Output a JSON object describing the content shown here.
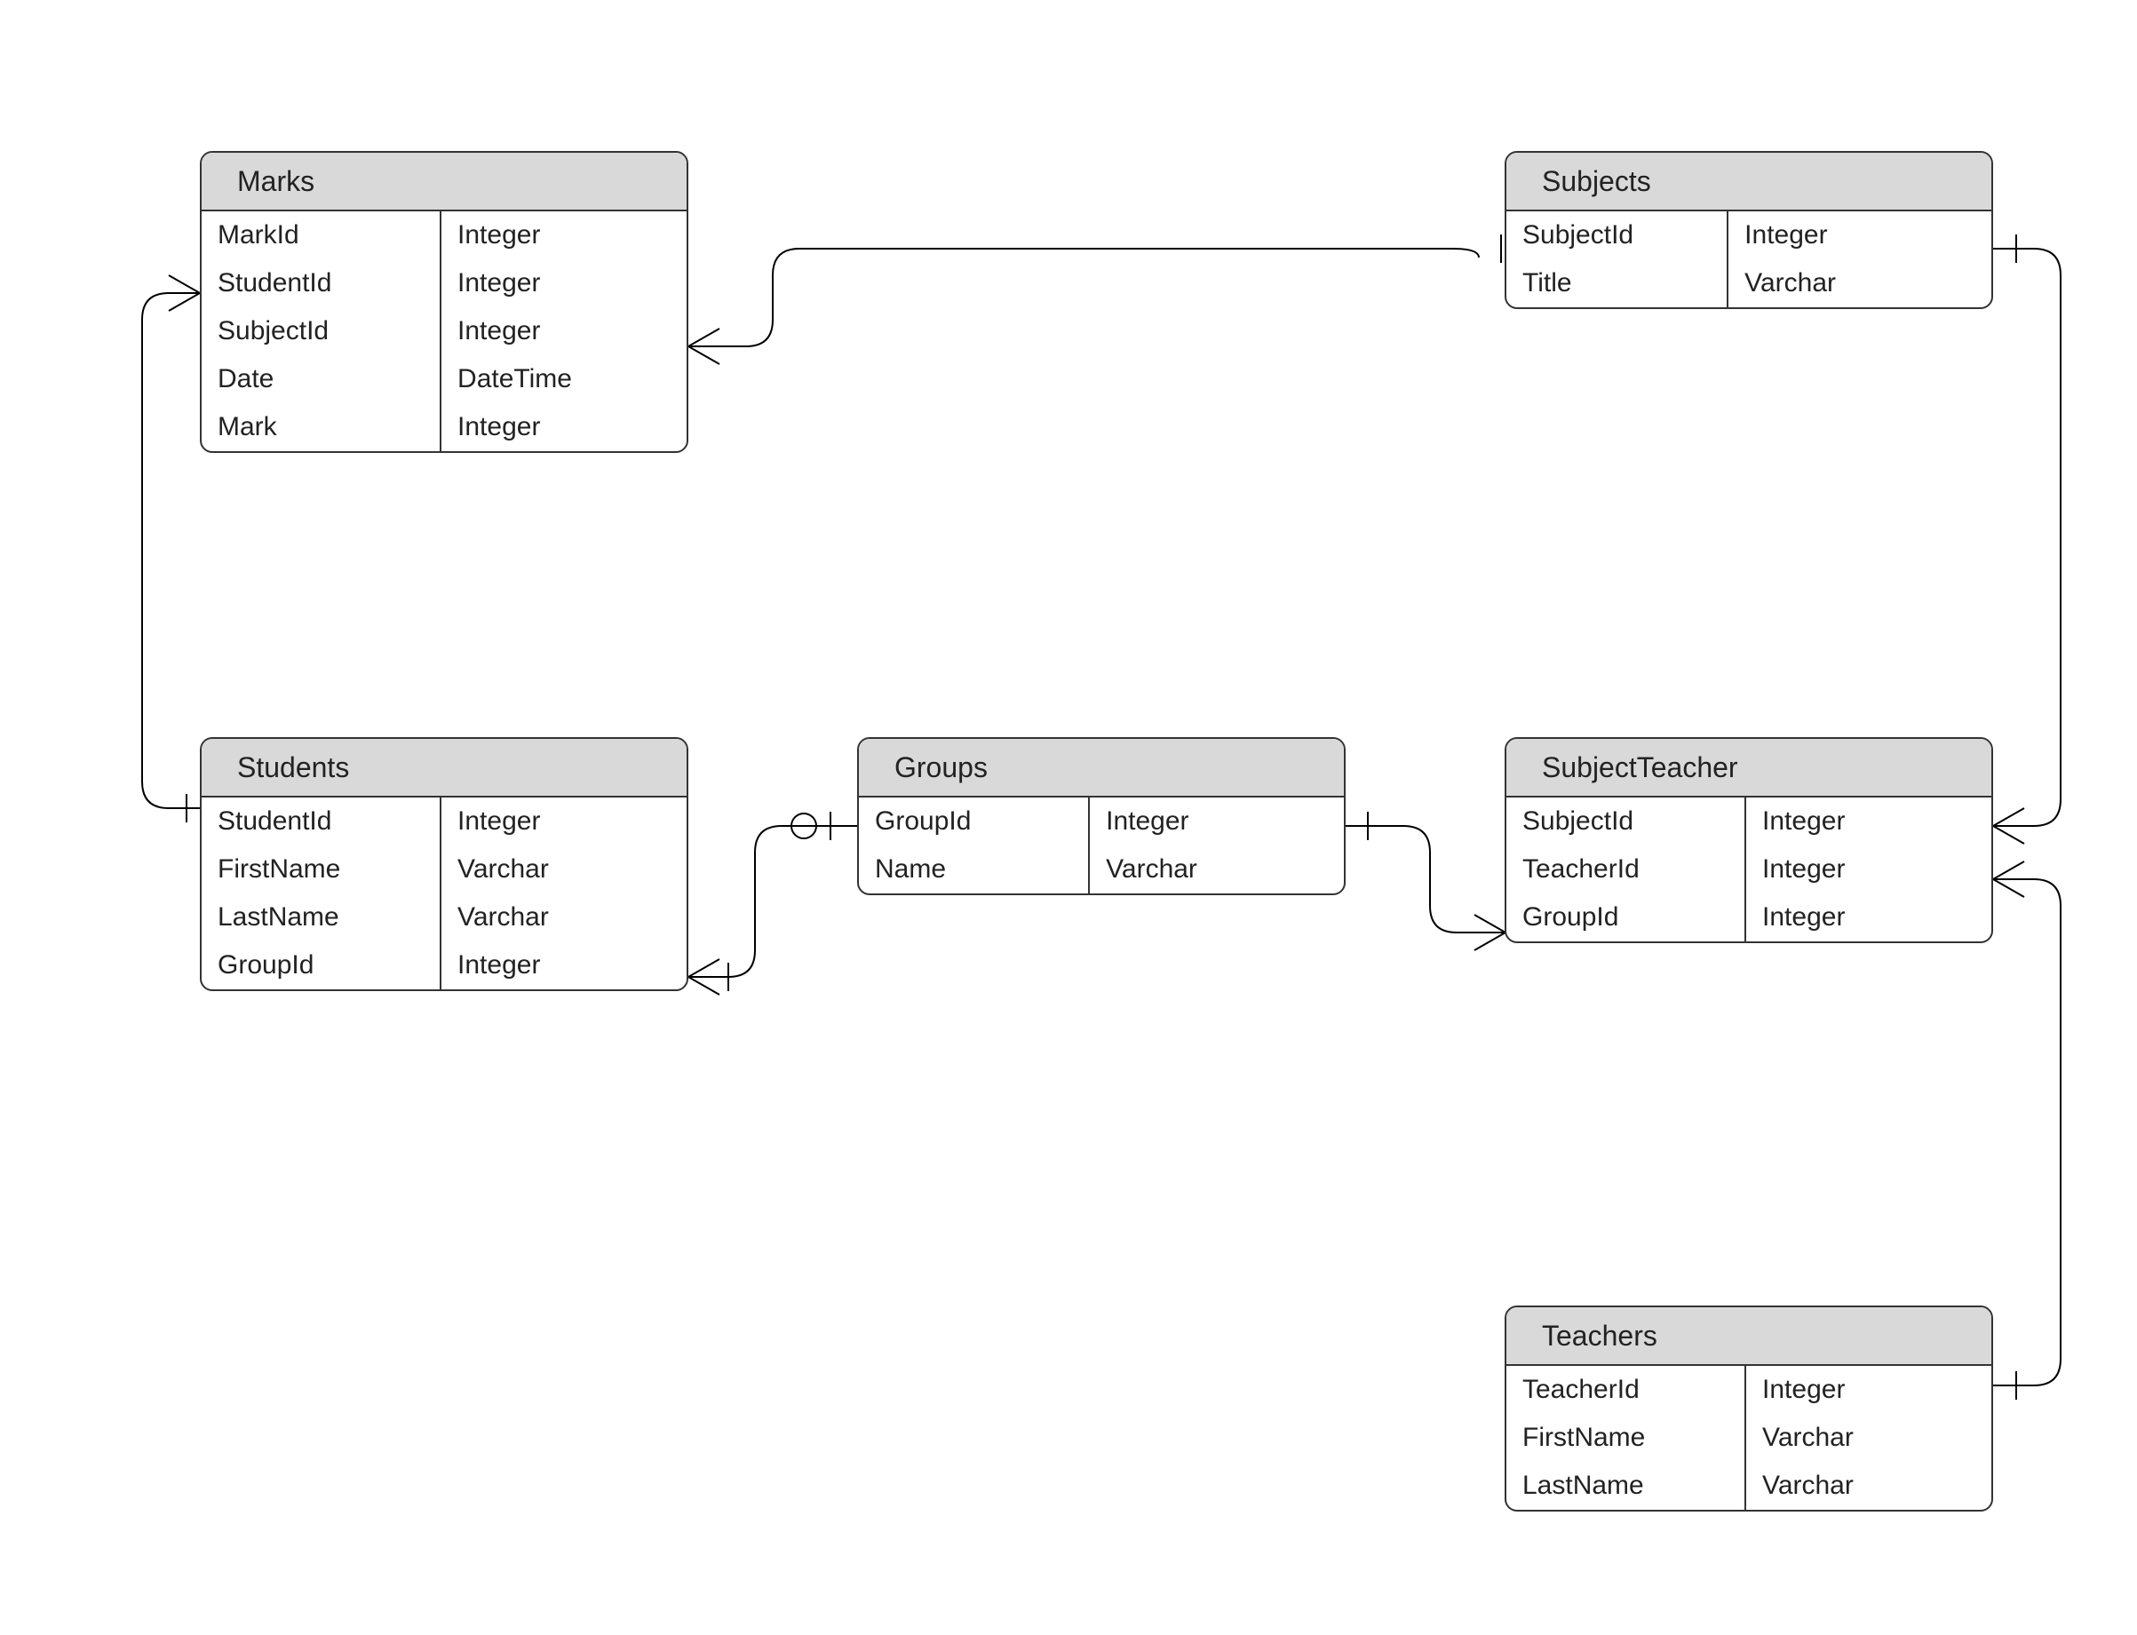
{
  "entities": {
    "marks": {
      "title": "Marks",
      "fields": [
        {
          "name": "MarkId",
          "type": "Integer"
        },
        {
          "name": "StudentId",
          "type": "Integer"
        },
        {
          "name": "SubjectId",
          "type": "Integer"
        },
        {
          "name": "Date",
          "type": "DateTime"
        },
        {
          "name": "Mark",
          "type": "Integer"
        }
      ]
    },
    "subjects": {
      "title": "Subjects",
      "fields": [
        {
          "name": "SubjectId",
          "type": "Integer"
        },
        {
          "name": "Title",
          "type": "Varchar"
        }
      ]
    },
    "students": {
      "title": "Students",
      "fields": [
        {
          "name": "StudentId",
          "type": "Integer"
        },
        {
          "name": "FirstName",
          "type": "Varchar"
        },
        {
          "name": "LastName",
          "type": "Varchar"
        },
        {
          "name": "GroupId",
          "type": "Integer"
        }
      ]
    },
    "groups": {
      "title": "Groups",
      "fields": [
        {
          "name": "GroupId",
          "type": "Integer"
        },
        {
          "name": "Name",
          "type": "Varchar"
        }
      ]
    },
    "subjectteacher": {
      "title": "SubjectTeacher",
      "fields": [
        {
          "name": "SubjectId",
          "type": "Integer"
        },
        {
          "name": "TeacherId",
          "type": "Integer"
        },
        {
          "name": "GroupId",
          "type": "Integer"
        }
      ]
    },
    "teachers": {
      "title": "Teachers",
      "fields": [
        {
          "name": "TeacherId",
          "type": "Integer"
        },
        {
          "name": "FirstName",
          "type": "Varchar"
        },
        {
          "name": "LastName",
          "type": "Varchar"
        }
      ]
    }
  },
  "relationships": [
    {
      "from": "Marks.SubjectId",
      "to": "Subjects.SubjectId",
      "from_card": "many",
      "to_card": "one"
    },
    {
      "from": "Marks.StudentId",
      "to": "Students.StudentId",
      "from_card": "many",
      "to_card": "one"
    },
    {
      "from": "Students.GroupId",
      "to": "Groups.GroupId",
      "from_card": "one-or-many",
      "to_card": "zero-or-one"
    },
    {
      "from": "SubjectTeacher.GroupId",
      "to": "Groups.GroupId",
      "from_card": "many",
      "to_card": "one"
    },
    {
      "from": "SubjectTeacher.SubjectId",
      "to": "Subjects.SubjectId",
      "from_card": "many",
      "to_card": "one"
    },
    {
      "from": "SubjectTeacher.TeacherId",
      "to": "Teachers.TeacherId",
      "from_card": "many",
      "to_card": "one"
    }
  ]
}
